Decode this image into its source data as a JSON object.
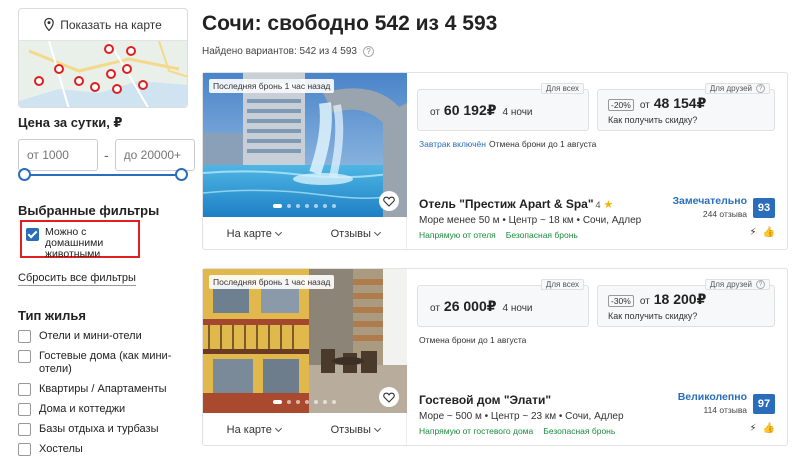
{
  "sidebar": {
    "map_button": "Показать на карте",
    "price_title": "Цена за сутки, ₽",
    "price_from_placeholder": "от 1000",
    "price_to_placeholder": "до 20000+",
    "price_separator": "-",
    "selected_filters_title": "Выбранные фильтры",
    "pet_filter": "Можно с домашними животными",
    "reset_filters": "Сбросить все фильтры",
    "type_title": "Тип жилья",
    "types": [
      {
        "label": "Отели и мини-отели"
      },
      {
        "label": "Гостевые дома (как мини-отели)"
      },
      {
        "label": "Квартиры / Апартаменты"
      },
      {
        "label": "Дома и коттеджи"
      },
      {
        "label": "Базы отдыха и турбазы"
      },
      {
        "label": "Хостелы"
      }
    ]
  },
  "main": {
    "title": "Сочи: свободно 542 из 4 593",
    "found": "Найдено вариантов: 542 из 4 593",
    "cards": [
      {
        "badge": "Последняя бронь 1 час назад",
        "tab_map": "На карте",
        "tab_reviews": "Отзывы",
        "tag_all": "Для всех",
        "tag_friends": "Для друзей",
        "price_from": "от",
        "price": "60 192₽",
        "nights": "4 ночи",
        "discount": "-20%",
        "friends_price": "48 154₽",
        "how_discount": "Как получить скидку?",
        "breakfast": "Завтрак включён",
        "cancel": "Отмена брони до 1 августа",
        "name": "Отель \"Престиж Apart & Spa\"",
        "stars": "4",
        "location": "Море менее 50 м • Центр ~ 18 км • Сочи, Адлер",
        "tag1": "Напрямую от отеля",
        "tag2": "Безопасная бронь",
        "rating_word": "Замечательно",
        "rating_count": "244 отзыва",
        "rating": "93"
      },
      {
        "badge": "Последняя бронь 1 час назад",
        "tab_map": "На карте",
        "tab_reviews": "Отзывы",
        "tag_all": "Для всех",
        "tag_friends": "Для друзей",
        "price_from": "от",
        "price": "26 000₽",
        "nights": "4 ночи",
        "discount": "-30%",
        "friends_price": "18 200₽",
        "how_discount": "Как получить скидку?",
        "cancel": "Отмена брони до 1 августа",
        "name": "Гостевой дом \"Элати\"",
        "location": "Море ~ 500 м • Центр ~ 23 км • Сочи, Адлер",
        "tag1": "Напрямую от гостевого дома",
        "tag2": "Безопасная бронь",
        "rating_word": "Великолепно",
        "rating_count": "114 отзыва",
        "rating": "97"
      }
    ]
  },
  "colors": {
    "accent": "#2a6ebb",
    "highlight_border": "#e02020",
    "green": "#1a8c3c",
    "star": "#f2b300"
  }
}
